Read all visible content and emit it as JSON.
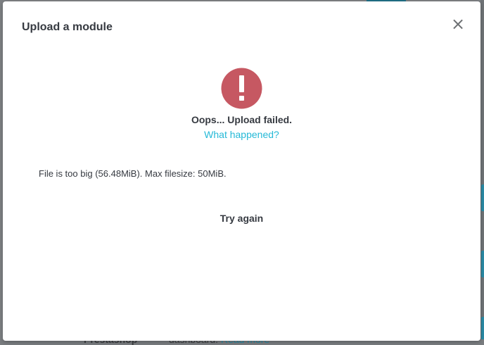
{
  "modal": {
    "title": "Upload a module",
    "close_icon": "close-icon",
    "close_glyph": "×",
    "alert_icon": "exclamation-circle-icon",
    "alert_color": "#c65862",
    "fail_title": "Oops... Upload failed.",
    "fail_link": "What happened?",
    "error_message": "File is too big (56.48MiB). Max filesize: 50MiB.",
    "retry_label": "Try again"
  },
  "background": {
    "module_name": "Prestashop",
    "module_desc": "dashboard.",
    "module_link": "Read more"
  },
  "colors": {
    "link": "#25b9d7",
    "text": "#363a41"
  }
}
